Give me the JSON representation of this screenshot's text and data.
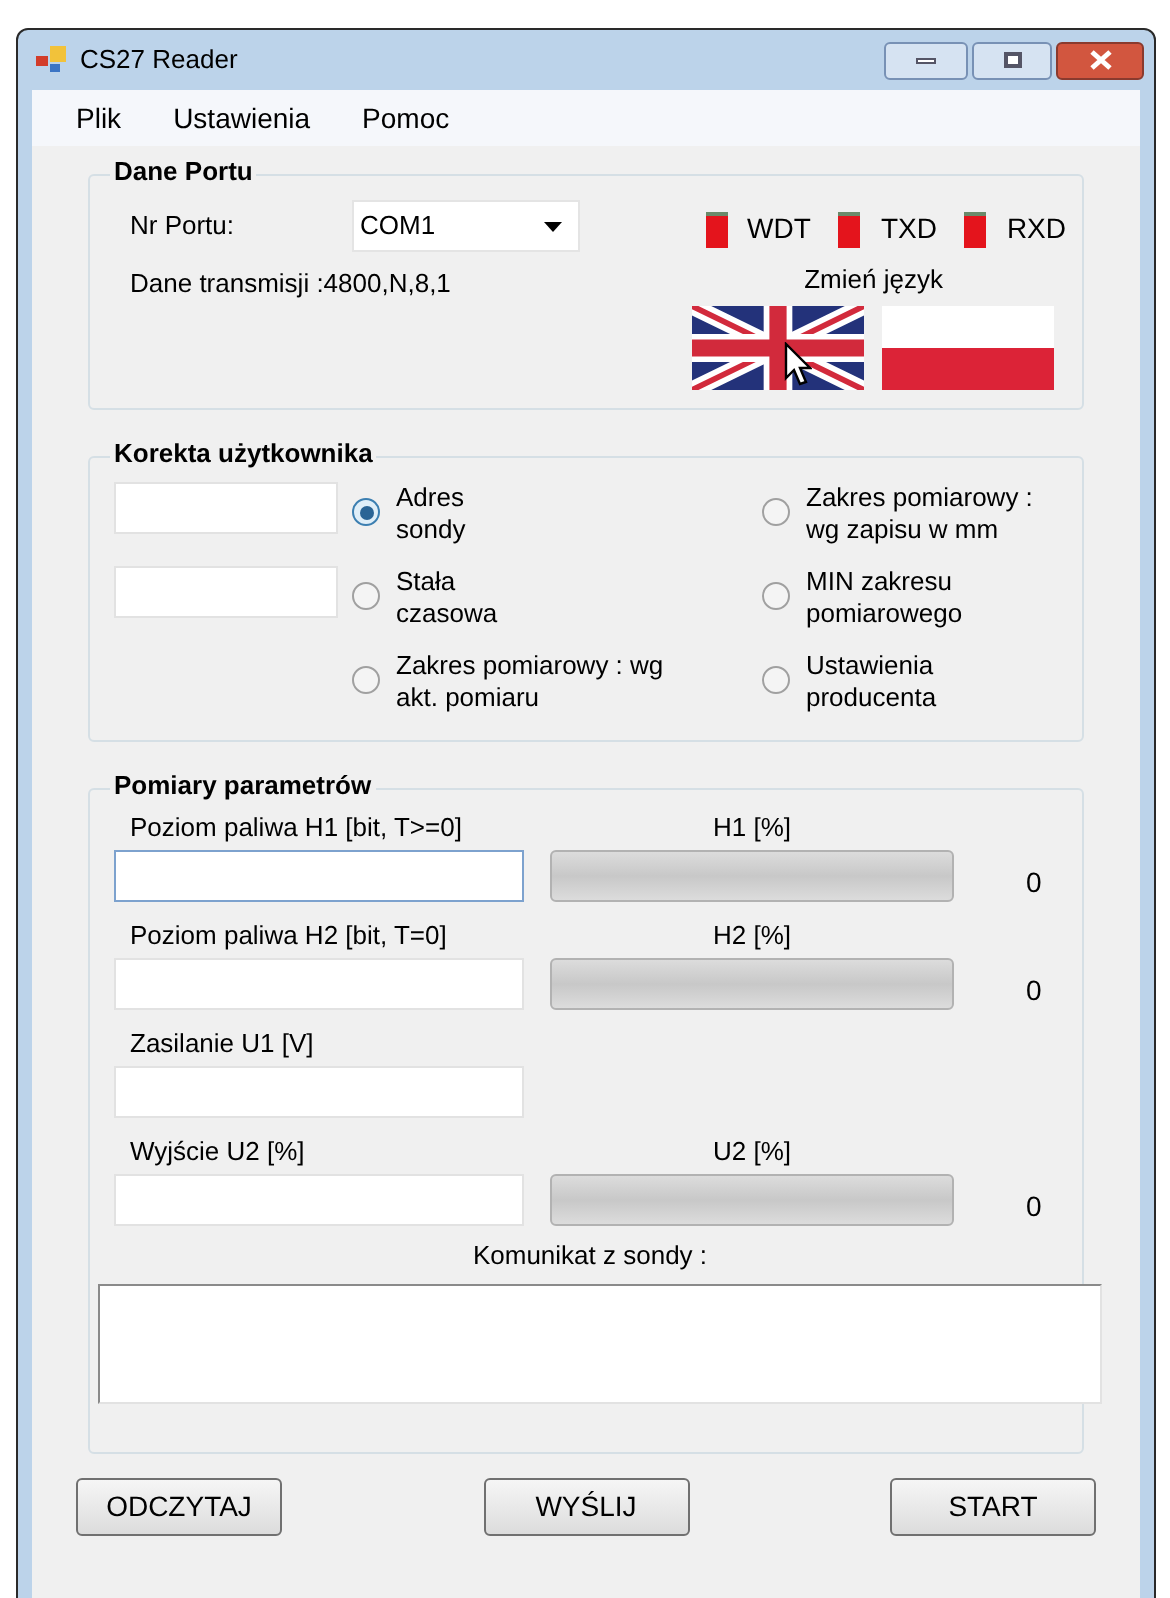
{
  "window": {
    "title": "CS27 Reader"
  },
  "menu": [
    "Plik",
    "Ustawienia",
    "Pomoc"
  ],
  "port_group": {
    "title": "Dane Portu",
    "port_label": "Nr Portu:",
    "port_value": "COM1",
    "transmission": "Dane transmisji :4800,N,8,1",
    "indicators": [
      {
        "label": "WDT",
        "on": true
      },
      {
        "label": "TXD",
        "on": true
      },
      {
        "label": "RXD",
        "on": true
      }
    ],
    "language_label": "Zmień język",
    "languages": [
      {
        "kind": "uk"
      },
      {
        "kind": "pl"
      }
    ]
  },
  "correction_group": {
    "title": "Korekta użytkownika",
    "fields": [
      {
        "focused": false
      },
      {
        "focused": false
      }
    ],
    "options": [
      {
        "lines": [
          "Adres",
          "sondy"
        ],
        "selected": true
      },
      {
        "lines": [
          "Zakres pomiarowy :",
          "wg zapisu w mm"
        ],
        "selected": false
      },
      {
        "lines": [
          "Stała",
          "czasowa"
        ],
        "selected": false
      },
      {
        "lines": [
          "MIN zakresu",
          "pomiarowego"
        ],
        "selected": false
      },
      {
        "lines": [
          "Zakres pomiarowy : wg",
          "akt. pomiaru"
        ],
        "selected": false
      },
      {
        "lines": [
          "Ustawienia",
          "producenta"
        ],
        "selected": false
      }
    ]
  },
  "measure_group": {
    "title": "Pomiary parametrów",
    "rows": [
      {
        "label": "Poziom paliwa H1 [bit, T>=0]",
        "focused": true,
        "meter": {
          "label": "H1 [%]",
          "level": 0,
          "reading": "0"
        }
      },
      {
        "label": "Poziom paliwa H2 [bit, T=0]",
        "focused": false,
        "meter": {
          "label": "H2 [%]",
          "level": 0,
          "reading": "0"
        }
      },
      {
        "label": "Zasilanie U1 [V]",
        "focused": false
      },
      {
        "label": "Wyjście U2 [%]",
        "focused": false,
        "meter": {
          "label": "U2 [%]",
          "level": 0,
          "reading": "0"
        }
      }
    ],
    "message_label": "Komunikat z sondy :"
  },
  "buttons": [
    "ODCZYTAJ",
    "WYŚLIJ",
    "START"
  ]
}
